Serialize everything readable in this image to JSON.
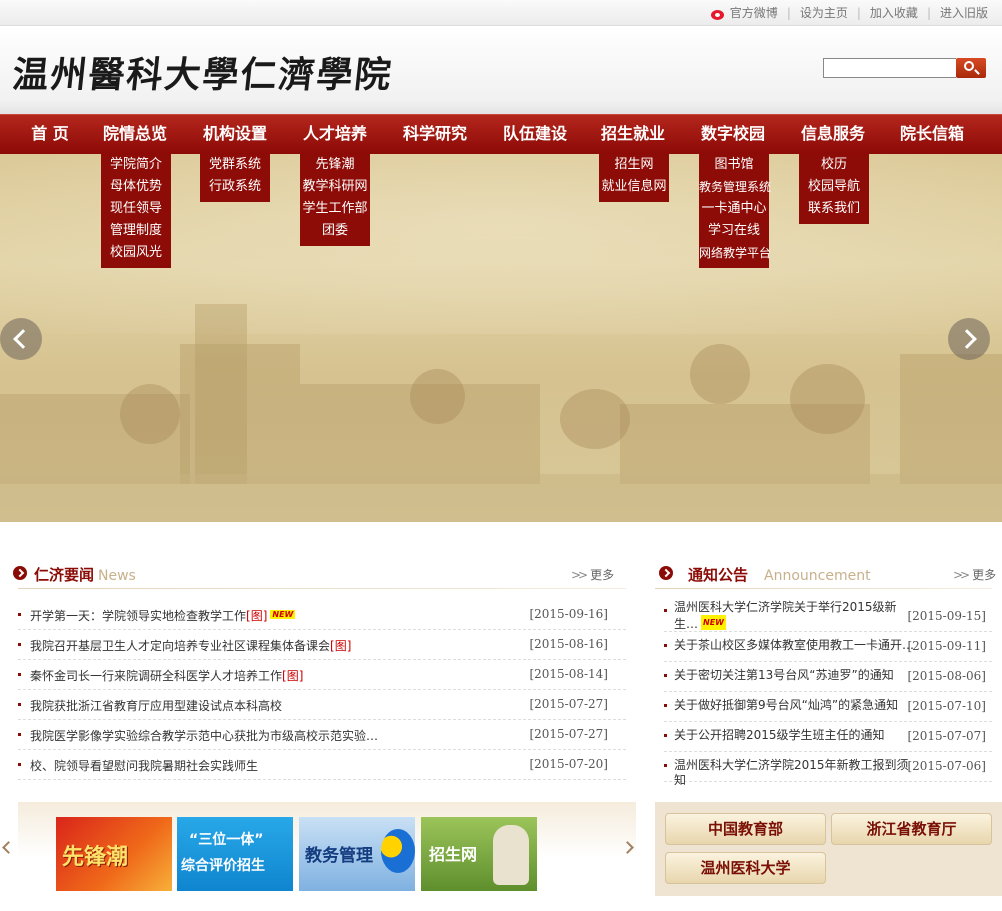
{
  "topbar": {
    "weibo": "官方微博",
    "home": "设为主页",
    "favorite": "加入收藏",
    "old": "进入旧版"
  },
  "header": {
    "logo": "温州醫科大學仁濟學院"
  },
  "search": {
    "value": ""
  },
  "nav": [
    {
      "label": "首  页"
    },
    {
      "label": "院情总览"
    },
    {
      "label": "机构设置"
    },
    {
      "label": "人才培养"
    },
    {
      "label": "科学研究"
    },
    {
      "label": "队伍建设"
    },
    {
      "label": "招生就业"
    },
    {
      "label": "数字校园"
    },
    {
      "label": "信息服务"
    },
    {
      "label": "院长信箱"
    }
  ],
  "dropdowns": {
    "overview": [
      "学院简介",
      "母体优势",
      "现任领导",
      "管理制度",
      "校园风光"
    ],
    "org": [
      "党群系统",
      "行政系统"
    ],
    "talent": [
      "先锋潮",
      "教学科研网",
      "学生工作部",
      "团委"
    ],
    "admission": [
      "招生网",
      "就业信息网"
    ],
    "digital": [
      "图书馆",
      "教务管理系统",
      "一卡通中心",
      "学习在线",
      "网络教学平台"
    ],
    "info": [
      "校历",
      "校园导航",
      "联系我们"
    ]
  },
  "news": {
    "title": "仁济要闻",
    "title_en": "News",
    "more": "更多",
    "img_tag": "[图]",
    "new_badge": "NEW",
    "items": [
      {
        "text": "开学第一天：学院领导实地检查教学工作",
        "date": "[2015-09-16]"
      },
      {
        "text": "我院召开基层卫生人才定向培养专业社区课程集体备课会",
        "date": "[2015-08-16]"
      },
      {
        "text": "秦怀金司长一行来院调研全科医学人才培养工作",
        "date": "[2015-08-14]"
      },
      {
        "text": "我院获批浙江省教育厅应用型建设试点本科高校",
        "date": "[2015-07-27]"
      },
      {
        "text": "我院医学影像学实验综合教学示范中心获批为市级高校示范实验…",
        "date": "[2015-07-27]"
      },
      {
        "text": "校、院领导看望慰问我院暑期社会实践师生",
        "date": "[2015-07-20]"
      }
    ]
  },
  "notice": {
    "title": "通知公告",
    "title_en": "Announcement",
    "more": "更多",
    "new_badge": "NEW",
    "items": [
      {
        "text": "温州医科大学仁济学院关于举行2015级新生…",
        "date": "[2015-09-15]"
      },
      {
        "text": "关于茶山校区多媒体教室使用教工一卡通开…",
        "date": "[2015-09-11]"
      },
      {
        "text": "关于密切关注第13号台风“苏迪罗”的通知",
        "date": "[2015-08-06]"
      },
      {
        "text": "关于做好抵御第9号台风“灿鸿”的紧急通知",
        "date": "[2015-07-10]"
      },
      {
        "text": "关于公开招聘2015级学生班主任的通知",
        "date": "[2015-07-07]"
      },
      {
        "text": "温州医科大学仁济学院2015年新教工报到须知",
        "date": "[2015-07-06]"
      }
    ]
  },
  "thumbs": [
    {
      "label": "先锋潮"
    },
    {
      "label": "“三位一体”",
      "label2": "综合评价招生"
    },
    {
      "label": "教务管理"
    },
    {
      "label": "招生网"
    }
  ],
  "friend_links": [
    "中国教育部",
    "浙江省教育厅",
    "温州医科大学"
  ],
  "colors": {
    "brand_red": "#8b0c06",
    "nav_red": "#a0170f",
    "banner_tan": "#d9c692"
  }
}
